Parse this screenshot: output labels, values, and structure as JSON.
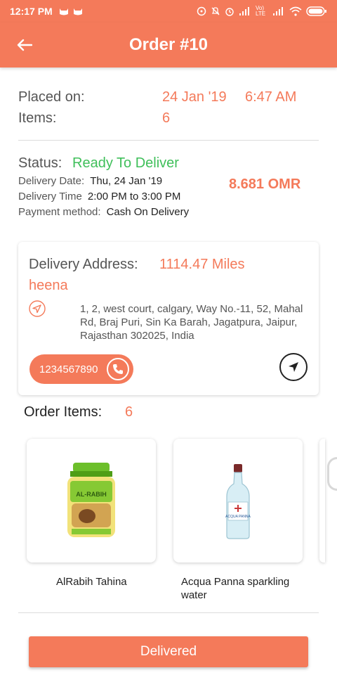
{
  "status_bar": {
    "time": "12:17 PM",
    "network_label": "Vo) LTE"
  },
  "header": {
    "title": "Order #10"
  },
  "order": {
    "placed_label": "Placed on:",
    "placed_date": "24 Jan '19",
    "placed_time": "6:47 AM",
    "items_label": "Items:",
    "items_count": "6"
  },
  "status": {
    "label": "Status:",
    "value": "Ready To Deliver",
    "delivery_date_label": "Delivery Date:",
    "delivery_date": "Thu, 24 Jan '19",
    "delivery_time_label": "Delivery Time",
    "delivery_time": "2:00 PM to 3:00 PM",
    "payment_label": "Payment method:",
    "payment_value": "Cash On Delivery",
    "total": "8.681 OMR"
  },
  "address": {
    "label": "Delivery Address:",
    "distance": "1114.47 Miles",
    "name": "heena",
    "text": "1, 2, west court, calgary, Way No.-11, 52, Mahal Rd, Braj Puri, Sin Ka Barah, Jagatpura, Jaipur, Rajasthan 302025, India",
    "phone": "1234567890"
  },
  "order_items": {
    "label": "Order Items:",
    "count": "6",
    "items": [
      {
        "name": "AlRabih Tahina",
        "product_label": "AL-RABIH"
      },
      {
        "name": "Acqua Panna sparkling water",
        "product_label": "ACQUA PANNA"
      }
    ]
  },
  "actions": {
    "delivered_label": "Delivered"
  },
  "colors": {
    "accent": "#f47a5a",
    "status_green": "#3fbf5a"
  }
}
